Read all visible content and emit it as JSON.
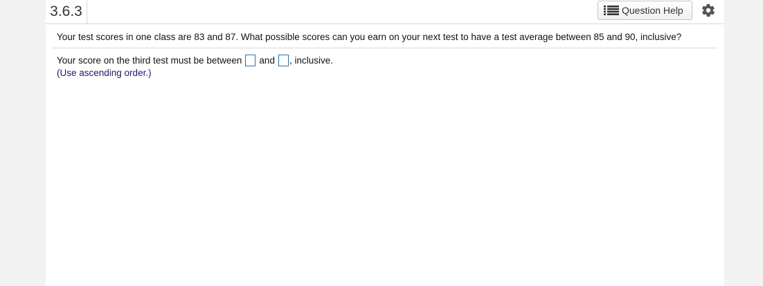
{
  "header": {
    "question_number": "3.6.3",
    "help_button_label": "Question Help",
    "help_icon": "list-icon",
    "settings_icon": "gear-icon"
  },
  "question": {
    "text": "Your test scores in one class are 83 and 87. What possible scores can you earn on your next test to have a test average between 85 and 90, inclusive?"
  },
  "answer": {
    "prefix": "Your score on the third test must be between",
    "connector": "and",
    "suffix": ", inclusive.",
    "box1_value": "",
    "box2_value": "",
    "hint": "(Use ascending order.)"
  },
  "colors": {
    "page_bg": "#f2f2f2",
    "panel_bg": "#ffffff",
    "answer_box_border": "#2a6ea8",
    "hint_text": "#1a1a6e"
  }
}
